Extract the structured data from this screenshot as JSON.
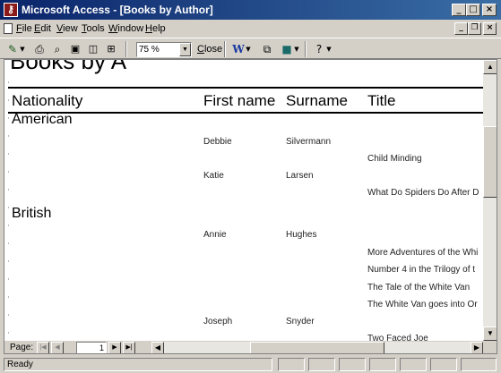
{
  "window": {
    "title": "Microsoft Access - [Books by Author]",
    "icon": "access-key-icon"
  },
  "menu": {
    "items": [
      {
        "underline": "F",
        "rest": "ile"
      },
      {
        "underline": "E",
        "rest": "dit"
      },
      {
        "underline": "V",
        "rest": "iew"
      },
      {
        "underline": "T",
        "rest": "ools"
      },
      {
        "underline": "W",
        "rest": "indow"
      },
      {
        "underline": "H",
        "rest": "elp"
      }
    ]
  },
  "toolbar": {
    "zoom": "75 %",
    "close_u": "C",
    "close_rest": "lose"
  },
  "report": {
    "title": "Books by A",
    "columns": [
      "Nationality",
      "First name",
      "Surname",
      "Title"
    ],
    "groups": [
      "American",
      "British"
    ],
    "authors": [
      {
        "first": "Debbie",
        "last": "Silvermann"
      },
      {
        "first": "Katie",
        "last": "Larsen"
      },
      {
        "first": "Annie",
        "last": "Hughes"
      },
      {
        "first": "Joseph",
        "last": "Snyder"
      }
    ],
    "titles": [
      "Child Minding",
      "What Do Spiders Do After D",
      "More Adventures of the Whi",
      "Number 4 in the Trilogy of t",
      "The Tale of the White Van",
      "The White Van goes into Or",
      "Two Faced Joe"
    ]
  },
  "nav": {
    "page_label": "Page:",
    "page_value": "1"
  },
  "status": {
    "text": "Ready"
  }
}
